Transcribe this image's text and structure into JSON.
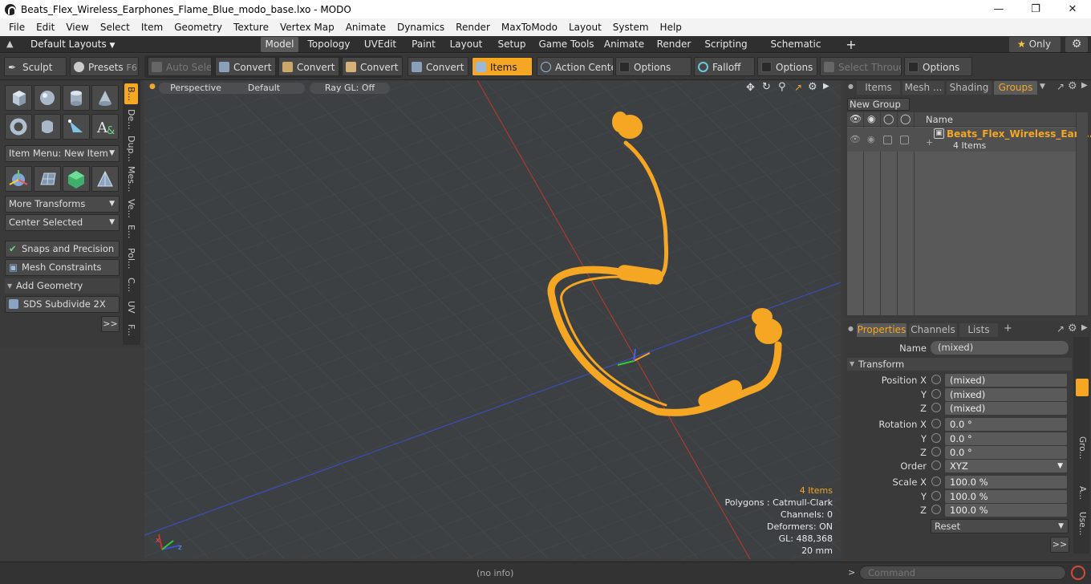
{
  "window": {
    "title": "Beats_Flex_Wireless_Earphones_Flame_Blue_modo_base.lxo - MODO"
  },
  "menu": [
    "File",
    "Edit",
    "View",
    "Select",
    "Item",
    "Geometry",
    "Texture",
    "Vertex Map",
    "Animate",
    "Dynamics",
    "Render",
    "MaxToModo",
    "Layout",
    "System",
    "Help"
  ],
  "layout_row": {
    "default_layouts": "Default Layouts",
    "tabs": [
      "Model",
      "Topology",
      "UVEdit",
      "Paint",
      "Layout",
      "Setup",
      "Game Tools",
      "Animate",
      "Render",
      "Scripting",
      "Schematic Fusion"
    ],
    "add": "+",
    "only": "Only"
  },
  "toolbar": {
    "sculpt": "Sculpt",
    "presets": "Presets",
    "presets_key": "F6",
    "auto_select": "Auto Select",
    "convert": "Convert",
    "items": "Items",
    "action_center": "Action Center",
    "options": "Options",
    "falloff": "Falloff",
    "select_through": "Select Through"
  },
  "left_panel": {
    "item_menu": "Item Menu: New Item",
    "more_transforms": "More Transforms",
    "center_selected": "Center Selected",
    "snaps": "Snaps and Precision",
    "mesh_constraints": "Mesh Constraints",
    "add_geometry": "Add Geometry",
    "sds": "SDS Subdivide 2X",
    "more": ">>",
    "vertical_tabs": [
      "B...",
      "De...",
      "Dup...",
      "Mes...",
      "Ve...",
      "E...",
      "Pol...",
      "C...",
      "UV",
      "F..."
    ]
  },
  "viewport": {
    "perspective": "Perspective",
    "default": "Default",
    "raygl": "Ray GL: Off",
    "stats": {
      "items": "4 Items",
      "polygons": "Polygons : Catmull-Clark",
      "channels": "Channels: 0",
      "deformers": "Deformers: ON",
      "gl": "GL: 488,368",
      "scale": "20 mm"
    }
  },
  "status": {
    "info": "(no info)",
    "command_placeholder": "Command"
  },
  "groups_panel": {
    "tabs": [
      "Items",
      "Mesh ...",
      "Shading",
      "Groups"
    ],
    "new_group": "New Group",
    "name_header": "Name",
    "group_name": "Beats_Flex_Wireless_Ear ...",
    "group_count": "4 Items"
  },
  "properties_panel": {
    "tabs": [
      "Properties",
      "Channels",
      "Lists"
    ],
    "add": "+",
    "name_label": "Name",
    "name_value": "(mixed)",
    "transform": "Transform",
    "position_label": "Position X",
    "rotation_label": "Rotation X",
    "scale_label": "Scale X",
    "y": "Y",
    "z": "Z",
    "position": [
      "(mixed)",
      "(mixed)",
      "(mixed)"
    ],
    "rotation": [
      "0.0 °",
      "0.0 °",
      "0.0 °"
    ],
    "order_label": "Order",
    "order_value": "XYZ",
    "scale": [
      "100.0 %",
      "100.0 %",
      "100.0 %"
    ],
    "reset": "Reset",
    "more": ">>",
    "side_tabs": [
      "Gro...",
      "A...",
      "Use..."
    ]
  },
  "colors": {
    "accent": "#f5a623",
    "viewport_bg": "#3d4042",
    "mesh": "#f5a623"
  }
}
